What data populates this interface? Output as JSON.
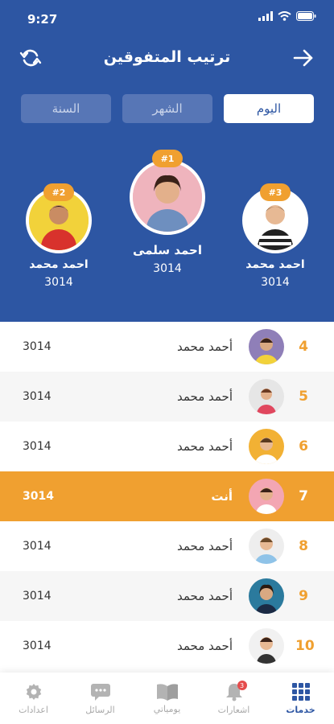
{
  "status": {
    "time": "9:27"
  },
  "header": {
    "title": "ترتيب المتفوقين"
  },
  "tabs": [
    {
      "label": "اليوم",
      "active": true
    },
    {
      "label": "الشهر",
      "active": false
    },
    {
      "label": "السنة",
      "active": false
    }
  ],
  "podium": {
    "first": {
      "rank": "#1",
      "name": "احمد سلمى",
      "score": "3014"
    },
    "second": {
      "rank": "#2",
      "name": "احمد محمد",
      "score": "3014"
    },
    "third": {
      "rank": "#3",
      "name": "احمد محمد",
      "score": "3014"
    }
  },
  "ranking": [
    {
      "rank": "4",
      "name": "أحمد محمد",
      "score": "3014",
      "avatar_bg": "#8f7fb8"
    },
    {
      "rank": "5",
      "name": "أحمد محمد",
      "score": "3014",
      "avatar_bg": "#e6e6e6"
    },
    {
      "rank": "6",
      "name": "أحمد محمد",
      "score": "3014",
      "avatar_bg": "#f2b134"
    },
    {
      "rank": "7",
      "name": "أنت",
      "score": "3014",
      "avatar_bg": "#f3a6b3",
      "highlight": true
    },
    {
      "rank": "8",
      "name": "أحمد محمد",
      "score": "3014",
      "avatar_bg": "#eeeeee"
    },
    {
      "rank": "9",
      "name": "أحمد محمد",
      "score": "3014",
      "avatar_bg": "#2b7a9d"
    },
    {
      "rank": "10",
      "name": "أحمد محمد",
      "score": "3014",
      "avatar_bg": "#f1f1f1"
    }
  ],
  "nav": {
    "services": "خدمات",
    "notifications": "اشعارات",
    "notifications_count": "3",
    "diary": "يومياتي",
    "messages": "الرسائل",
    "settings": "اعدادات"
  },
  "colors": {
    "primary": "#2d56a3",
    "accent": "#f0a030"
  }
}
